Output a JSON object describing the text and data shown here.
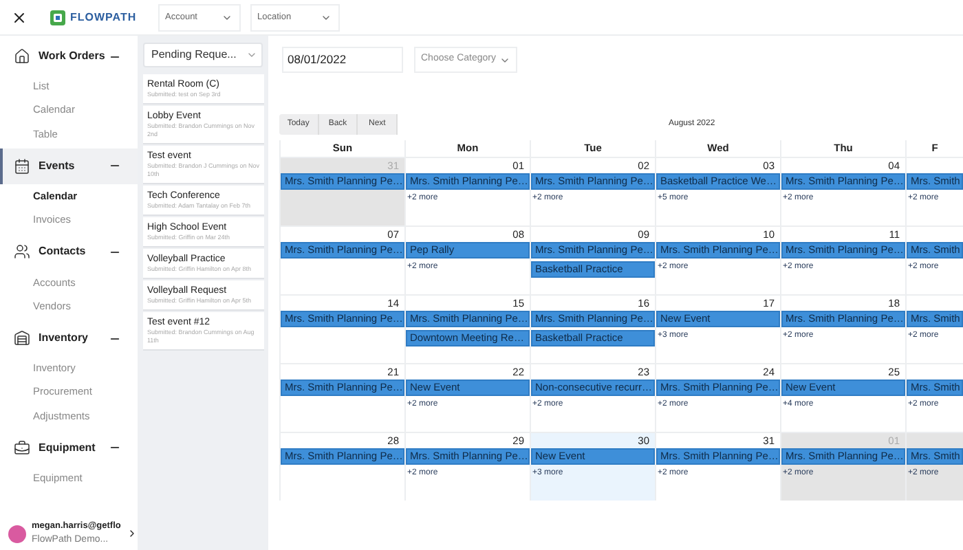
{
  "top_bar": {
    "logo_text": "FLOWPATH",
    "filters": [
      {
        "label": "Account"
      },
      {
        "label": "Location"
      }
    ]
  },
  "sidebar": {
    "sections": [
      {
        "kind": "home",
        "label": "Work Orders",
        "selected": false,
        "expanded": true,
        "items": [
          {
            "label": "List",
            "selected": false
          },
          {
            "label": "Calendar",
            "selected": false
          },
          {
            "label": "Table",
            "selected": false
          }
        ]
      },
      {
        "kind": "calendar",
        "label": "Events",
        "selected": true,
        "expanded": true,
        "items": [
          {
            "label": "Calendar",
            "selected": true
          },
          {
            "label": "Invoices",
            "selected": false
          }
        ]
      },
      {
        "kind": "people",
        "label": "Contacts",
        "selected": false,
        "expanded": true,
        "items": [
          {
            "label": "Accounts",
            "selected": false
          },
          {
            "label": "Vendors",
            "selected": false
          }
        ]
      },
      {
        "kind": "warehouse",
        "label": "Inventory",
        "selected": false,
        "expanded": true,
        "items": [
          {
            "label": "Inventory",
            "selected": false
          },
          {
            "label": "Procurement",
            "selected": false
          },
          {
            "label": "Adjustments",
            "selected": false
          }
        ]
      },
      {
        "kind": "toolbox",
        "label": "Equipment",
        "selected": false,
        "expanded": true,
        "items": [
          {
            "label": "Equipment",
            "selected": false
          }
        ]
      }
    ],
    "user": {
      "email": "megan.harris@getflo",
      "org": "FlowPath Demo..."
    }
  },
  "requests": {
    "filter": "Pending Reque...",
    "items": [
      {
        "title": "Rental Room (C)",
        "subtitle": "Submitted: test on Sep 3rd"
      },
      {
        "title": "Lobby Event",
        "subtitle": "Submitted: Brandon Cummings on Nov 2nd"
      },
      {
        "title": "Test event",
        "subtitle": "Submitted: Brandon J Cummings on Nov 10th"
      },
      {
        "title": "Tech Conference",
        "subtitle": "Submitted: Adam Tantalay on Feb 7th"
      },
      {
        "title": "High School Event",
        "subtitle": "Submitted: Griffin on Mar 24th"
      },
      {
        "title": "Volleyball Practice",
        "subtitle": "Submitted: Griffin Hamilton on Apr 8th"
      },
      {
        "title": "Volleyball Request",
        "subtitle": "Submitted: Griffin Hamilton on Apr 5th"
      },
      {
        "title": "Test event #12",
        "subtitle": "Submitted: Brandon Cummings on Aug 11th"
      }
    ]
  },
  "filters": {
    "date": "08/01/2022",
    "category_placeholder": "Choose Category"
  },
  "calendar": {
    "nav_buttons": [
      "Today",
      "Back",
      "Next"
    ],
    "month_label": "August 2022",
    "weekdays": [
      "Sun",
      "Mon",
      "Tue",
      "Wed",
      "Thu",
      "F"
    ],
    "weeks": [
      {
        "days": [
          {
            "number": "31",
            "outside_month": true,
            "today": false,
            "events": [
              "Mrs. Smith Planning Pe…"
            ]
          },
          {
            "number": "01",
            "outside_month": false,
            "today": false,
            "events": [
              "Mrs. Smith Planning Pe…"
            ],
            "more": "+2 more"
          },
          {
            "number": "02",
            "outside_month": false,
            "today": false,
            "events": [
              "Mrs. Smith Planning Pe…"
            ],
            "more": "+2 more"
          },
          {
            "number": "03",
            "outside_month": false,
            "today": false,
            "events": [
              "Basketball Practice We…"
            ],
            "more": "+5 more"
          },
          {
            "number": "04",
            "outside_month": false,
            "today": false,
            "events": [
              "Mrs. Smith Planning Pe…"
            ],
            "more": "+2 more"
          },
          {
            "outside_month": false,
            "today": false,
            "events": [
              "Mrs. Smith"
            ],
            "more": "+2 more"
          }
        ]
      },
      {
        "days": [
          {
            "number": "07",
            "outside_month": false,
            "today": false,
            "events": [
              "Mrs. Smith Planning Pe…"
            ]
          },
          {
            "number": "08",
            "outside_month": false,
            "today": false,
            "events": [
              "Pep Rally"
            ],
            "more": "+2 more"
          },
          {
            "number": "09",
            "outside_month": false,
            "today": false,
            "events": [
              "Mrs. Smith Planning Pe…",
              "Basketball Practice"
            ]
          },
          {
            "number": "10",
            "outside_month": false,
            "today": false,
            "events": [
              "Mrs. Smith Planning Pe…"
            ],
            "more": "+2 more"
          },
          {
            "number": "11",
            "outside_month": false,
            "today": false,
            "events": [
              "Mrs. Smith Planning Pe…"
            ],
            "more": "+2 more"
          },
          {
            "outside_month": false,
            "today": false,
            "events": [
              "Mrs. Smith"
            ],
            "more": "+2 more"
          }
        ]
      },
      {
        "days": [
          {
            "number": "14",
            "outside_month": false,
            "today": false,
            "events": [
              "Mrs. Smith Planning Pe…"
            ]
          },
          {
            "number": "15",
            "outside_month": false,
            "today": false,
            "events": [
              "Mrs. Smith Planning Pe…",
              "Downtown Meeting Re…"
            ]
          },
          {
            "number": "16",
            "outside_month": false,
            "today": false,
            "events": [
              "Mrs. Smith Planning Pe…",
              "Basketball Practice"
            ]
          },
          {
            "number": "17",
            "outside_month": false,
            "today": false,
            "events": [
              "New Event"
            ],
            "more": "+3 more"
          },
          {
            "number": "18",
            "outside_month": false,
            "today": false,
            "events": [
              "Mrs. Smith Planning Pe…"
            ],
            "more": "+2 more"
          },
          {
            "outside_month": false,
            "today": false,
            "events": [
              "Mrs. Smith"
            ],
            "more": "+2 more"
          }
        ]
      },
      {
        "days": [
          {
            "number": "21",
            "outside_month": false,
            "today": false,
            "events": [
              "Mrs. Smith Planning Pe…"
            ]
          },
          {
            "number": "22",
            "outside_month": false,
            "today": false,
            "events": [
              "New Event"
            ],
            "more": "+2 more"
          },
          {
            "number": "23",
            "outside_month": false,
            "today": false,
            "events": [
              "Non-consecutive recurr…"
            ],
            "more": "+2 more"
          },
          {
            "number": "24",
            "outside_month": false,
            "today": false,
            "events": [
              "Mrs. Smith Planning Pe…"
            ],
            "more": "+2 more"
          },
          {
            "number": "25",
            "outside_month": false,
            "today": false,
            "events": [
              "New Event"
            ],
            "more": "+4 more"
          },
          {
            "outside_month": false,
            "today": false,
            "events": [
              "Mrs. Smith"
            ],
            "more": "+2 more"
          }
        ]
      },
      {
        "days": [
          {
            "number": "28",
            "outside_month": false,
            "today": false,
            "events": [
              "Mrs. Smith Planning Pe…"
            ]
          },
          {
            "number": "29",
            "outside_month": false,
            "today": false,
            "events": [
              "Mrs. Smith Planning Pe…"
            ],
            "more": "+2 more"
          },
          {
            "number": "30",
            "outside_month": false,
            "today": true,
            "events": [
              "New Event"
            ],
            "more": "+3 more"
          },
          {
            "number": "31",
            "outside_month": false,
            "today": false,
            "events": [
              "Mrs. Smith Planning Pe…"
            ],
            "more": "+2 more"
          },
          {
            "number": "01",
            "outside_month": true,
            "today": false,
            "events": [
              "Mrs. Smith Planning Pe…"
            ],
            "more": "+2 more"
          },
          {
            "outside_month": true,
            "today": false,
            "events": [
              "Mrs. Smith"
            ],
            "more": "+2 more"
          }
        ]
      }
    ]
  }
}
